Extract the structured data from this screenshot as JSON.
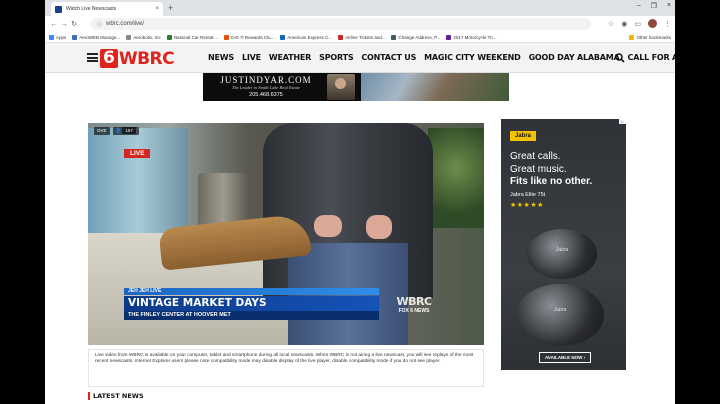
{
  "browser": {
    "tab_title": "Watch Live Newscasts",
    "tab_close": "×",
    "new_tab": "+",
    "url": "wbrc.com/live/",
    "window_controls": [
      "–",
      "❐",
      "×"
    ]
  },
  "bookmarks": {
    "items": [
      {
        "label": "Apps",
        "color": "#4285f4"
      },
      {
        "label": "AeroWEB Manage...",
        "color": "#3b6fb6"
      },
      {
        "label": "Aerobotix, Inc",
        "color": "#888888"
      },
      {
        "label": "National Car Rental:...",
        "color": "#2e7d32"
      },
      {
        "label": "IHG ® Rewards Clu...",
        "color": "#e65100"
      },
      {
        "label": "American Express C...",
        "color": "#1565c0"
      },
      {
        "label": "Airline Tickets and...",
        "color": "#c62828"
      },
      {
        "label": "Change Address, P...",
        "color": "#455a64"
      },
      {
        "label": "2017 Motorcycle Tri...",
        "color": "#6a1b9a"
      }
    ],
    "other": "Other bookmarks"
  },
  "site": {
    "logo_six": "6",
    "logo_text": "WBRC",
    "menu": [
      "NEWS",
      "LIVE",
      "WEATHER",
      "SPORTS",
      "CONTACT US",
      "MAGIC CITY WEEKEND",
      "GOOD DAY ALABAMA",
      "CALL FOR ACTION"
    ]
  },
  "banner_ad": {
    "site": "JUSTINDYAR.COM",
    "tagline": "The Leader in Smith Lake Real Estate",
    "phone": "205.468.6375"
  },
  "video": {
    "badge_left": "OVE",
    "viewers": "157",
    "live_label": "LIVE",
    "ticker": "JEH JEH LIVE",
    "headline": "VINTAGE MARKET DAYS",
    "subline": "THE FINLEY CENTER AT HOOVER MET",
    "bug_logo": "WBRC",
    "bug_sub": "FOX 6 NEWS"
  },
  "description": "Live video from WBRC is available on your computer, tablet and smartphone during all local newscasts. When WBRC is not airing a live newscast, you will see replays of the most recent newscasts. Internet Explorer users please note compatibility mode may disable display of the live player, disable compatibility mode if you do not see player.",
  "latest_news": "LATEST NEWS",
  "side_ad": {
    "ad_choice": "▷",
    "brand": "Jabra",
    "line1": "Great calls.",
    "line2": "Great music.",
    "line3": "Fits like no other.",
    "model": "Jabra Elite 75t",
    "stars": "★★★★★",
    "bud_label": "Jabra",
    "cta": "AVAILABLE NOW ›"
  },
  "colors": {
    "brand_red": "#e0231c",
    "jabra_yellow": "#f3c300"
  }
}
